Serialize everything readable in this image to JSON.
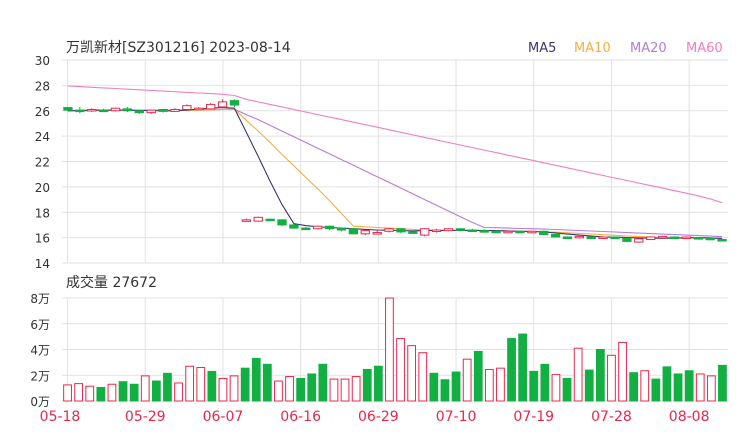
{
  "colors": {
    "up": "#e8294a",
    "down": "#12b043",
    "ma5": "#3b3574",
    "ma10": "#f5b043",
    "ma20": "#b57ddb",
    "ma60": "#f080c0",
    "grid": "#e2e2e2",
    "axis_text": "#333333",
    "date_text": "#e8294a"
  },
  "chart_data": [
    {
      "type": "candlestick",
      "title": "万凯新材[SZ301216] 2023-08-14",
      "ylim": [
        14,
        30
      ],
      "yticks": [
        "30",
        "28",
        "26",
        "24",
        "22",
        "20",
        "18",
        "16",
        "14"
      ],
      "legend": [
        {
          "name": "MA5",
          "key": "ma5"
        },
        {
          "name": "MA10",
          "key": "ma10"
        },
        {
          "name": "MA20",
          "key": "ma20"
        },
        {
          "name": "MA60",
          "key": "ma60"
        }
      ],
      "ohlc": [
        [
          26.25,
          26.05,
          26.3,
          25.95
        ],
        [
          26.05,
          26.0,
          26.3,
          25.8
        ],
        [
          26.0,
          26.1,
          26.2,
          25.9
        ],
        [
          26.05,
          26.0,
          26.15,
          25.9
        ],
        [
          26.0,
          26.2,
          26.25,
          25.95
        ],
        [
          26.15,
          26.0,
          26.3,
          25.9
        ],
        [
          26.0,
          25.85,
          26.05,
          25.75
        ],
        [
          25.85,
          26.05,
          26.1,
          25.75
        ],
        [
          26.1,
          25.95,
          26.15,
          25.85
        ],
        [
          25.95,
          26.1,
          26.2,
          25.9
        ],
        [
          26.1,
          26.4,
          26.5,
          26.0
        ],
        [
          26.2,
          26.2,
          26.3,
          26.05
        ],
        [
          26.15,
          26.5,
          26.6,
          26.1
        ],
        [
          26.3,
          26.7,
          26.9,
          26.2
        ],
        [
          26.8,
          26.45,
          26.9,
          26.3
        ],
        [
          17.4,
          17.4,
          17.5,
          17.3
        ],
        [
          17.3,
          17.6,
          17.65,
          17.25
        ],
        [
          17.45,
          17.4,
          17.5,
          17.3
        ],
        [
          17.4,
          17.0,
          17.45,
          16.9
        ],
        [
          17.0,
          16.75,
          17.1,
          16.7
        ],
        [
          16.75,
          16.7,
          16.85,
          16.6
        ],
        [
          16.7,
          16.9,
          16.95,
          16.65
        ],
        [
          16.9,
          16.7,
          16.95,
          16.6
        ],
        [
          16.75,
          16.6,
          16.8,
          16.5
        ],
        [
          16.7,
          16.3,
          16.75,
          16.25
        ],
        [
          16.3,
          16.55,
          16.6,
          16.2
        ],
        [
          16.4,
          16.4,
          16.55,
          16.3
        ],
        [
          16.5,
          16.7,
          16.75,
          16.4
        ],
        [
          16.7,
          16.45,
          16.75,
          16.35
        ],
        [
          16.45,
          16.35,
          16.5,
          16.3
        ],
        [
          16.2,
          16.7,
          16.75,
          16.1
        ],
        [
          16.5,
          16.6,
          16.7,
          16.4
        ],
        [
          16.55,
          16.7,
          16.75,
          16.5
        ],
        [
          16.7,
          16.6,
          16.75,
          16.5
        ],
        [
          16.6,
          16.55,
          16.7,
          16.45
        ],
        [
          16.55,
          16.5,
          16.65,
          16.45
        ],
        [
          16.5,
          16.45,
          16.6,
          16.4
        ],
        [
          16.45,
          16.5,
          16.55,
          16.35
        ],
        [
          16.5,
          16.4,
          16.55,
          16.35
        ],
        [
          16.4,
          16.5,
          16.55,
          16.35
        ],
        [
          16.5,
          16.25,
          16.55,
          16.2
        ],
        [
          16.25,
          16.05,
          16.3,
          16.0
        ],
        [
          16.05,
          16.0,
          16.1,
          15.95
        ],
        [
          16.0,
          16.1,
          16.15,
          15.95
        ],
        [
          16.05,
          16.0,
          16.1,
          15.95
        ],
        [
          15.95,
          16.05,
          16.1,
          15.9
        ],
        [
          16.05,
          15.95,
          16.1,
          15.9
        ],
        [
          15.95,
          15.7,
          16.0,
          15.65
        ],
        [
          15.65,
          15.9,
          15.95,
          15.6
        ],
        [
          15.85,
          16.05,
          16.1,
          15.8
        ],
        [
          16.0,
          16.1,
          16.15,
          15.95
        ],
        [
          16.05,
          16.0,
          16.1,
          15.95
        ],
        [
          16.0,
          16.05,
          16.1,
          15.95
        ],
        [
          16.0,
          15.95,
          16.05,
          15.9
        ],
        [
          15.95,
          15.85,
          16.0,
          15.8
        ],
        [
          15.85,
          15.75,
          15.9,
          15.7
        ]
      ],
      "ma": {
        "ma5": [
          26.0,
          26.02,
          26.05,
          26.05,
          26.06,
          26.05,
          26.03,
          26.02,
          26.0,
          26.0,
          26.05,
          26.12,
          26.2,
          26.25,
          26.2,
          24.3,
          22.4,
          20.45,
          18.6,
          17.1,
          16.95,
          16.85,
          16.8,
          16.75,
          16.7,
          16.65,
          16.6,
          16.58,
          16.56,
          16.53,
          16.55,
          16.56,
          16.56,
          16.57,
          16.58,
          16.57,
          16.55,
          16.53,
          16.5,
          16.48,
          16.44,
          16.37,
          16.28,
          16.2,
          16.12,
          16.06,
          16.04,
          16.0,
          15.98,
          15.96,
          15.95,
          15.96,
          15.98,
          16.0,
          15.98,
          15.94
        ],
        "ma10": [
          26.0,
          26.0,
          26.02,
          26.03,
          26.05,
          26.05,
          26.05,
          26.05,
          26.04,
          26.03,
          26.03,
          26.05,
          26.07,
          26.1,
          26.13,
          25.25,
          24.4,
          23.5,
          22.55,
          21.65,
          20.75,
          19.85,
          18.9,
          17.9,
          16.9,
          16.85,
          16.8,
          16.75,
          16.7,
          16.65,
          16.62,
          16.6,
          16.58,
          16.56,
          16.55,
          16.54,
          16.53,
          16.52,
          16.51,
          16.5,
          16.47,
          16.43,
          16.38,
          16.33,
          16.28,
          16.23,
          16.18,
          16.13,
          16.08,
          16.04,
          16.02,
          16.0,
          15.99,
          15.98,
          15.97,
          15.94
        ],
        "ma20": [
          26.0,
          26.0,
          26.0,
          26.02,
          26.03,
          26.04,
          26.05,
          26.05,
          26.05,
          26.05,
          26.06,
          26.07,
          26.08,
          26.1,
          26.12,
          25.7,
          25.3,
          24.85,
          24.4,
          23.95,
          23.5,
          23.05,
          22.6,
          22.15,
          21.7,
          21.25,
          20.8,
          20.35,
          19.9,
          19.45,
          19.0,
          18.55,
          18.1,
          17.65,
          17.2,
          16.8,
          16.78,
          16.75,
          16.72,
          16.7,
          16.67,
          16.64,
          16.6,
          16.56,
          16.52,
          16.48,
          16.44,
          16.4,
          16.36,
          16.32,
          16.28,
          16.24,
          16.2,
          16.16,
          16.12,
          16.08
        ],
        "ma60": [
          27.95,
          27.9,
          27.85,
          27.8,
          27.75,
          27.7,
          27.65,
          27.6,
          27.55,
          27.5,
          27.45,
          27.4,
          27.35,
          27.3,
          27.2,
          26.9,
          26.7,
          26.5,
          26.3,
          26.1,
          25.9,
          25.7,
          25.5,
          25.3,
          25.1,
          24.9,
          24.7,
          24.5,
          24.3,
          24.1,
          23.9,
          23.7,
          23.5,
          23.3,
          23.1,
          22.9,
          22.7,
          22.5,
          22.3,
          22.1,
          21.9,
          21.7,
          21.5,
          21.3,
          21.1,
          20.9,
          20.7,
          20.5,
          20.3,
          20.1,
          19.9,
          19.7,
          19.5,
          19.3,
          19.05,
          18.75
        ]
      }
    },
    {
      "type": "bar",
      "title": "成交量 27672",
      "ylim": [
        0,
        80000
      ],
      "yticks": [
        "8万",
        "6万",
        "4万",
        "2万",
        "0万"
      ],
      "x_labels": [
        "05-18",
        "05-29",
        "06-07",
        "06-16",
        "06-29",
        "07-10",
        "07-19",
        "07-28",
        "08-08"
      ],
      "values": [
        12500,
        13500,
        11500,
        10500,
        13000,
        15000,
        13000,
        19500,
        15500,
        21500,
        14000,
        27000,
        26000,
        23000,
        17500,
        19500,
        25500,
        33000,
        28500,
        15500,
        19000,
        17500,
        21000,
        28500,
        17000,
        17000,
        19000,
        24500,
        27000,
        80000,
        48500,
        43000,
        37500,
        21500,
        16500,
        22500,
        32500,
        38500,
        24500,
        25500,
        48500,
        52000,
        23000,
        28500,
        20500,
        17500,
        41000,
        24000,
        40000,
        35500,
        45500,
        22000,
        23500,
        17000,
        26500,
        21000,
        23500,
        21000,
        19500,
        27672
      ],
      "up": [
        true,
        true,
        true,
        false,
        true,
        false,
        false,
        true,
        false,
        false,
        true,
        true,
        true,
        false,
        true,
        true,
        false,
        false,
        false,
        true,
        true,
        false,
        false,
        false,
        true,
        true,
        true,
        false,
        false,
        true,
        true,
        true,
        true,
        false,
        false,
        false,
        true,
        false,
        true,
        true,
        false,
        false,
        false,
        false,
        true,
        false,
        true,
        false,
        false,
        true,
        true,
        false,
        true,
        false,
        false,
        false,
        false,
        true,
        true,
        false
      ]
    }
  ]
}
